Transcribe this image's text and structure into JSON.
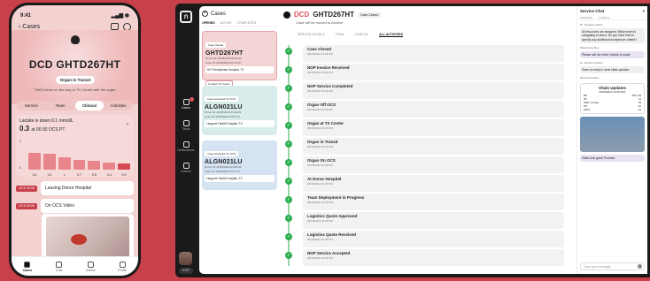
{
  "phone": {
    "time": "9:41",
    "back_label": "‹ Cases",
    "case_id": "DCD GHTD267HT",
    "status_pill": "Organ in Transit",
    "hero_sub": "TMOX team on the way to TX Center with the organ",
    "tabs": [
      "Service",
      "Team",
      "Clinical",
      "Activities"
    ],
    "active_tab": "Clinical",
    "lactate": {
      "title": "Lactate is down 0.1 mmol/L",
      "value": "0.3",
      "unit": "at 00:30 OCS PT",
      "bars": [
        {
          "v": "1.6",
          "h": 0.55
        },
        {
          "v": "1.5",
          "h": 0.52
        },
        {
          "v": "1",
          "h": 0.4
        },
        {
          "v": "0.7",
          "h": 0.32
        },
        {
          "v": "0.5",
          "h": 0.28
        },
        {
          "v": "0.4",
          "h": 0.25
        },
        {
          "v": "0.3",
          "h": 0.22
        }
      ],
      "y_top": "2",
      "y_bottom": "0"
    },
    "timeline": [
      {
        "tag": "OCS 00:30",
        "label": "Leaving Donor Hospital"
      },
      {
        "tag": "OCS 00:25",
        "label": "On OCS Video"
      }
    ],
    "tabbar": [
      "Cases",
      "Chat",
      "Hotline",
      "Profile"
    ]
  },
  "desk": {
    "rail": [
      "Cases",
      "Tasks",
      "Notifications",
      "Archive"
    ],
    "exit": "EXIT",
    "cases_title": "Cases",
    "cases_tabs": [
      "OPENED",
      "ACTIVE",
      "COMPLETED"
    ],
    "cards": [
      {
        "chip": "Case Closed",
        "id": "GHTD267HT",
        "meta1": "Donor ID: 06/18/2024 04:43:07",
        "meta2": "Case ID: 06/18/2024 01:14:10",
        "hosp": "NY Presbyterian Hospital, TX",
        "btn": "Contact TX Center",
        "color": "red"
      },
      {
        "chip": "Case Accepted for OCS",
        "id": "ALGN021LU",
        "meta1": "Donor ID: 06/18/2024 03:46:23",
        "meta2": "Case ID: 06/18/2024 04:57:11",
        "hosp": "Langone Health Hospital, TX",
        "btn": "",
        "color": "teal"
      },
      {
        "chip": "Case Accepted for OCS",
        "id": "ALGN021LU",
        "meta1": "Donor ID: 06/18/2024 03:46:23",
        "meta2": "Case ID: 06/18/2024 04:57:11",
        "hosp": "Langone Health Hospital, TX",
        "btn": "",
        "color": "blue"
      }
    ],
    "main": {
      "dcd": "DCD",
      "gid": "GHTD267HT",
      "closed": "Case Closed",
      "sub": "Case will be moved to Archive",
      "tabs": [
        "SERVICE DETAILS",
        "TEAM",
        "CLINICAL",
        "ALL ACTIVITIES"
      ],
      "events": [
        {
          "t": "Case Closed",
          "d": "06/18/2024 01:39 PM"
        },
        {
          "t": "NOP Invoice Received",
          "d": "06/18/2024 01:39 PM"
        },
        {
          "t": "NOP Service Completed",
          "d": "06/18/2024 01:39 PM"
        },
        {
          "t": "Organ Off OCS",
          "d": "06/18/2024 01:39 PM"
        },
        {
          "t": "Organ at TX Center",
          "d": "06/18/2024 01:39 PM"
        },
        {
          "t": "Organ in Transit",
          "d": "06/18/2024 01:39 PM"
        },
        {
          "t": "Organ On OCS",
          "d": "06/18/2024 01:39 PM"
        },
        {
          "t": "At Donor Hospital",
          "d": "06/18/2024 01:39 PM"
        },
        {
          "t": "Team Deployment in Progress",
          "d": "06/18/2024 01:39 PM"
        },
        {
          "t": "Logistics Quote Approved",
          "d": "06/18/2024 01:39 PM"
        },
        {
          "t": "Logistics Quote Received",
          "d": "06/18/2024 01:39 PM"
        },
        {
          "t": "NOP Service Accepted",
          "d": "06/18/2024 01:39 PM"
        }
      ]
    },
    "chat": {
      "title": "Service Chat",
      "tabs": [
        "GENERAL",
        "CLINICAL"
      ],
      "messages": [
        {
          "who": "Dr. Susana Landon",
          "text": "All resources are assigned. Milton team is navigating to donor. Do you have time to specify any additional acceptance criteria?",
          "me": false
        },
        {
          "who": "Minerva Fentley",
          "text": "Please call me when incision is made",
          "me": true
        },
        {
          "who": "Dr. Susana Landon",
          "text": "Team is ready to send vitals updates",
          "me": false
        },
        {
          "who": "Minerva Fentley",
          "text": "",
          "me": true
        }
      ],
      "vitals_title": "Vitals Updates",
      "vitals_date": "06/18/2024  12:45 EST",
      "vitals": [
        [
          "BP",
          "163 | 83"
        ],
        [
          "RT",
          "11"
        ],
        [
          "MAP, mmHg",
          "78"
        ],
        [
          "PP",
          "32"
        ],
        [
          "SAT2",
          "41"
        ]
      ],
      "photo_caption": "Vitals look good! Proceed",
      "input_placeholder": "Type your message"
    }
  }
}
